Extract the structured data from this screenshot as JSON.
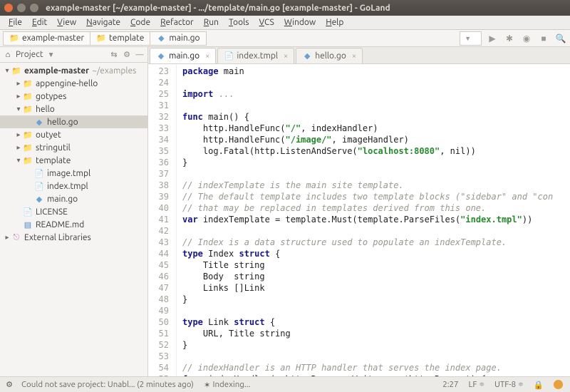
{
  "window": {
    "title": "example-master [~/example-master] - .../template/main.go [example-master] - GoLand"
  },
  "menu": [
    "File",
    "Edit",
    "View",
    "Navigate",
    "Code",
    "Refactor",
    "Run",
    "Tools",
    "VCS",
    "Window",
    "Help"
  ],
  "breadcrumbs": [
    {
      "icon": "folder-blue",
      "label": "example-master"
    },
    {
      "icon": "folder",
      "label": "template"
    },
    {
      "icon": "go",
      "label": "main.go"
    }
  ],
  "run_config_placeholder": " ",
  "project": {
    "title": "Project",
    "tree": [
      {
        "depth": 0,
        "twisty": "▾",
        "icon": "folder-blue",
        "label": "example-master",
        "bold": true,
        "hint": "~/examples"
      },
      {
        "depth": 1,
        "twisty": "▸",
        "icon": "folder",
        "label": "appengine-hello"
      },
      {
        "depth": 1,
        "twisty": "▸",
        "icon": "folder",
        "label": "gotypes"
      },
      {
        "depth": 1,
        "twisty": "▾",
        "icon": "folder",
        "label": "hello"
      },
      {
        "depth": 2,
        "twisty": "",
        "icon": "go",
        "label": "hello.go",
        "selected": true
      },
      {
        "depth": 1,
        "twisty": "▸",
        "icon": "folder",
        "label": "outyet"
      },
      {
        "depth": 1,
        "twisty": "▸",
        "icon": "folder",
        "label": "stringutil"
      },
      {
        "depth": 1,
        "twisty": "▾",
        "icon": "folder",
        "label": "template"
      },
      {
        "depth": 2,
        "twisty": "",
        "icon": "file",
        "label": "image.tmpl"
      },
      {
        "depth": 2,
        "twisty": "",
        "icon": "file",
        "label": "index.tmpl"
      },
      {
        "depth": 2,
        "twisty": "",
        "icon": "go",
        "label": "main.go"
      },
      {
        "depth": 1,
        "twisty": "",
        "icon": "file",
        "label": "LICENSE"
      },
      {
        "depth": 1,
        "twisty": "",
        "icon": "md",
        "label": "README.md"
      },
      {
        "depth": 0,
        "twisty": "▸",
        "icon": "lib",
        "label": "External Libraries"
      }
    ]
  },
  "tabs": [
    {
      "icon": "go",
      "label": "main.go",
      "active": true
    },
    {
      "icon": "file",
      "label": "index.tmpl",
      "active": false
    },
    {
      "icon": "go",
      "label": "hello.go",
      "active": false
    }
  ],
  "gutter": [
    "23",
    "24",
    "25",
    "31",
    "32",
    "33",
    "34",
    "35",
    "36",
    "37",
    "38",
    "39",
    "40",
    "41",
    "42",
    "43",
    "44",
    "45",
    "46",
    "47",
    "48",
    "49",
    "50",
    "51",
    "52",
    "53",
    "54",
    "55"
  ],
  "code_lines": [
    [
      {
        "t": "package ",
        "c": "kw"
      },
      {
        "t": "main"
      }
    ],
    [
      {
        "t": ""
      }
    ],
    [
      {
        "t": "import ",
        "c": "kw"
      },
      {
        "t": "...",
        "c": "fold"
      }
    ],
    [
      {
        "t": ""
      }
    ],
    [
      {
        "t": "func ",
        "c": "kw"
      },
      {
        "t": "main() {"
      }
    ],
    [
      {
        "t": "    http.HandleFunc("
      },
      {
        "t": "\"/\"",
        "c": "str"
      },
      {
        "t": ", indexHandler)"
      }
    ],
    [
      {
        "t": "    http.HandleFunc("
      },
      {
        "t": "\"/image/\"",
        "c": "str"
      },
      {
        "t": ", imageHandler)"
      }
    ],
    [
      {
        "t": "    log.Fatal(http.ListenAndServe("
      },
      {
        "t": "\"localhost:8080\"",
        "c": "str"
      },
      {
        "t": ", nil))"
      }
    ],
    [
      {
        "t": "}"
      }
    ],
    [
      {
        "t": ""
      }
    ],
    [
      {
        "t": "// indexTemplate is the main site template.",
        "c": "cm"
      }
    ],
    [
      {
        "t": "// The default template includes two template blocks (\"sidebar\" and \"con",
        "c": "cm"
      }
    ],
    [
      {
        "t": "// that may be replaced in templates derived from this one.",
        "c": "cm"
      }
    ],
    [
      {
        "t": "var ",
        "c": "kw"
      },
      {
        "t": "indexTemplate = template.Must(template.ParseFiles("
      },
      {
        "t": "\"index.tmpl\"",
        "c": "str"
      },
      {
        "t": "))"
      }
    ],
    [
      {
        "t": ""
      }
    ],
    [
      {
        "t": "// Index is a data structure used to populate an indexTemplate.",
        "c": "cm"
      }
    ],
    [
      {
        "t": "type ",
        "c": "kw"
      },
      {
        "t": "Index "
      },
      {
        "t": "struct ",
        "c": "kw"
      },
      {
        "t": "{"
      }
    ],
    [
      {
        "t": "    Title string"
      }
    ],
    [
      {
        "t": "    Body  string"
      }
    ],
    [
      {
        "t": "    Links []Link"
      }
    ],
    [
      {
        "t": "}"
      }
    ],
    [
      {
        "t": ""
      }
    ],
    [
      {
        "t": "type ",
        "c": "kw"
      },
      {
        "t": "Link "
      },
      {
        "t": "struct ",
        "c": "kw"
      },
      {
        "t": "{"
      }
    ],
    [
      {
        "t": "    URL, Title string"
      }
    ],
    [
      {
        "t": "}"
      }
    ],
    [
      {
        "t": ""
      }
    ],
    [
      {
        "t": "// indexHandler is an HTTP handler that serves the index page.",
        "c": "cm"
      }
    ],
    [
      {
        "t": "func ",
        "c": "kw"
      },
      {
        "t": "indexHandler(w http.ResponseWriter, r *http.Request) {"
      }
    ]
  ],
  "status": {
    "left_icon": "settings-icon",
    "message": "Could not save project: Unabl... (2 minutes ago)",
    "indexing": "Indexing...",
    "pos": "2:27",
    "line_sep": "LF",
    "encoding": "UTF-8"
  }
}
